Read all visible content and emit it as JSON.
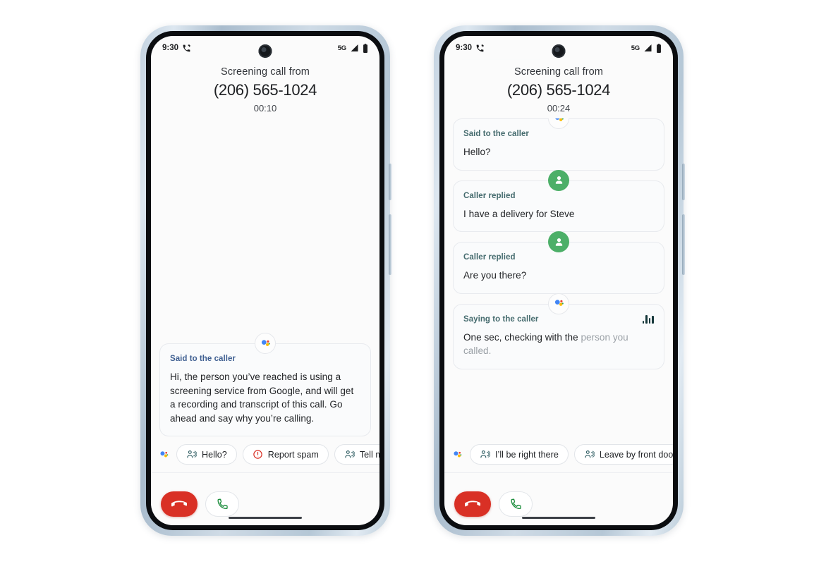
{
  "page": {
    "background": "#ffffff",
    "device_count": 2
  },
  "colors": {
    "assistant_blue": "#4285f4",
    "assistant_red": "#ea4335",
    "assistant_yellow": "#fbbc04",
    "assistant_green": "#34a853",
    "caller_avatar_green": "#4caf68",
    "end_call_red": "#d93025",
    "answer_call_green": "#1e8e3e",
    "report_spam_red": "#d93025",
    "label_blue": "#3f5f91",
    "label_slate": "#456b6e",
    "screen_background": "#fbfbfb",
    "bubble_background": "#fafbfc",
    "bubble_border": "#e8eaee",
    "dim_text": "#9aa0a6"
  },
  "phones": [
    {
      "id": "phone-left",
      "status_bar": {
        "time": "9:30",
        "call_icon": "call-screening-icon",
        "network": "5G",
        "signal_icon": "signal-bars-icon",
        "battery_icon": "battery-full-icon"
      },
      "header": {
        "screening_label": "Screening call from",
        "caller_number": "(206) 565-1024",
        "timer": "00:10"
      },
      "ghost_messages_visible": false,
      "transcript": [
        {
          "avatar": "assistant",
          "avatar_icon": "google-assistant-icon",
          "label": "Said to the caller",
          "label_style": "blue",
          "text": "Hi, the person you’ve reached is using a screening service from Google, and will get a recording and transcript of this call. Go ahead and say why you’re calling.",
          "dim_suffix": "",
          "waveform": false
        }
      ],
      "chips_leading_icon": "google-assistant-icon",
      "chips": [
        {
          "label": "Hello?",
          "icon": "speak-aloud-icon",
          "style": "normal"
        },
        {
          "label": "Report spam",
          "icon": "report-spam-icon",
          "style": "danger"
        },
        {
          "label": "Tell me more",
          "icon": "speak-aloud-icon",
          "style": "normal",
          "truncated": true
        }
      ],
      "actions": {
        "end_call": {
          "label": "End call",
          "icon": "end-call-icon"
        },
        "answer_call": {
          "label": "Answer call",
          "icon": "answer-call-icon"
        }
      }
    },
    {
      "id": "phone-right",
      "status_bar": {
        "time": "9:30",
        "call_icon": "call-screening-icon",
        "network": "5G",
        "signal_icon": "signal-bars-icon",
        "battery_icon": "battery-full-icon"
      },
      "header": {
        "screening_label": "Screening call from",
        "caller_number": "(206) 565-1024",
        "timer": "00:24"
      },
      "ghost_messages_visible": true,
      "transcript": [
        {
          "avatar": "assistant",
          "avatar_icon": "google-assistant-icon",
          "label": "Said to the caller",
          "label_style": "slate",
          "text": "Hello?",
          "dim_suffix": "",
          "waveform": false
        },
        {
          "avatar": "caller",
          "avatar_icon": "person-icon",
          "label": "Caller replied",
          "label_style": "slate",
          "text": "I have a delivery for Steve",
          "dim_suffix": "",
          "waveform": false
        },
        {
          "avatar": "caller",
          "avatar_icon": "person-icon",
          "label": "Caller replied",
          "label_style": "slate",
          "text": "Are you there?",
          "dim_suffix": "",
          "waveform": false
        },
        {
          "avatar": "assistant",
          "avatar_icon": "google-assistant-icon",
          "label": "Saying to the caller",
          "label_style": "slate",
          "text": "One sec, checking with the ",
          "dim_suffix": "person you called.",
          "waveform": true
        }
      ],
      "chips_leading_icon": "google-assistant-icon",
      "chips": [
        {
          "label": "I’ll be right there",
          "icon": "speak-aloud-icon",
          "style": "normal"
        },
        {
          "label": "Leave by front door",
          "icon": "speak-aloud-icon",
          "style": "normal"
        }
      ],
      "actions": {
        "end_call": {
          "label": "End call",
          "icon": "end-call-icon"
        },
        "answer_call": {
          "label": "Answer call",
          "icon": "answer-call-icon"
        }
      }
    }
  ]
}
